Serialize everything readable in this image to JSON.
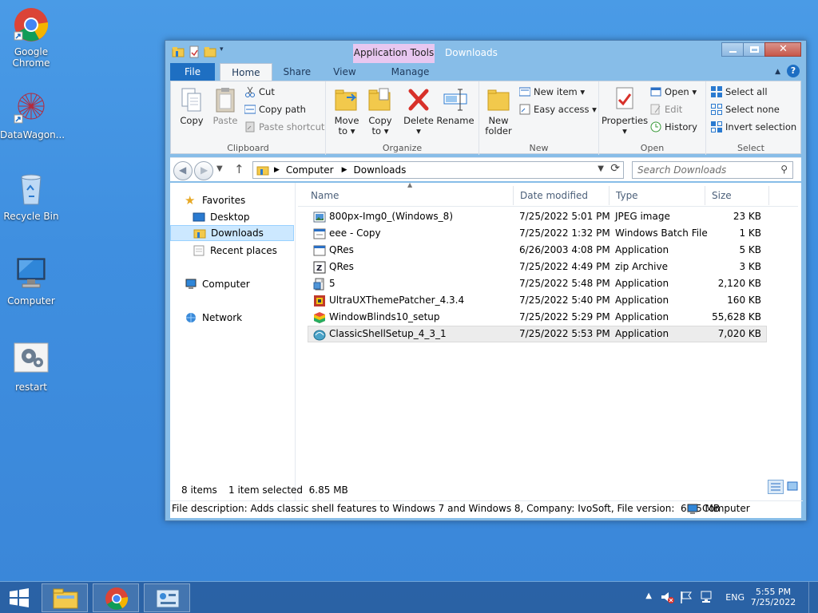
{
  "desktop": {
    "icons": [
      {
        "label": "Google Chrome",
        "icon": "chrome-icon"
      },
      {
        "label": "DataWagon...",
        "icon": "datawagon-icon"
      },
      {
        "label": "Recycle Bin",
        "icon": "recycle-bin-icon"
      },
      {
        "label": "Computer",
        "icon": "computer-icon"
      },
      {
        "label": "restart",
        "icon": "restart-icon"
      }
    ]
  },
  "window": {
    "title": "Downloads",
    "context_tab": "Application Tools",
    "tabs": [
      "File",
      "Home",
      "Share",
      "View",
      "Manage"
    ],
    "help": "?"
  },
  "ribbon": {
    "clipboard": {
      "label": "Clipboard",
      "copy": "Copy",
      "paste": "Paste",
      "cut": "Cut",
      "copy_path": "Copy path",
      "paste_shortcut": "Paste shortcut"
    },
    "organize": {
      "label": "Organize",
      "move_to": "Move to ▾",
      "copy_to": "Copy to ▾",
      "delete": "Delete ▾",
      "rename": "Rename"
    },
    "new": {
      "label": "New",
      "new_folder": "New folder",
      "new_item": "New item ▾",
      "easy_access": "Easy access ▾"
    },
    "open": {
      "label": "Open",
      "properties": "Properties ▾",
      "open": "Open ▾",
      "edit": "Edit",
      "history": "History"
    },
    "select": {
      "label": "Select",
      "select_all": "Select all",
      "select_none": "Select none",
      "invert": "Invert selection"
    }
  },
  "address": {
    "crumbs": [
      "Computer",
      "Downloads"
    ],
    "search_placeholder": "Search Downloads"
  },
  "navpane": {
    "favorites": "Favorites",
    "desktop": "Desktop",
    "downloads": "Downloads",
    "recent": "Recent places",
    "computer": "Computer",
    "network": "Network"
  },
  "columns": [
    "Name",
    "Date modified",
    "Type",
    "Size"
  ],
  "files": [
    {
      "name": "800px-Img0_(Windows_8)",
      "date": "7/25/2022 5:01 PM",
      "type": "JPEG image",
      "size": "23 KB",
      "icon": "jpeg-icon"
    },
    {
      "name": "eee - Copy",
      "date": "7/25/2022 1:32 PM",
      "type": "Windows Batch File",
      "size": "1 KB",
      "icon": "batch-icon"
    },
    {
      "name": "QRes",
      "date": "6/26/2003 4:08 PM",
      "type": "Application",
      "size": "5 KB",
      "icon": "app-icon"
    },
    {
      "name": "QRes",
      "date": "7/25/2022 4:49 PM",
      "type": "zip Archive",
      "size": "3 KB",
      "icon": "zip-icon"
    },
    {
      "name": "5",
      "date": "7/25/2022 5:48 PM",
      "type": "Application",
      "size": "2,120 KB",
      "icon": "setup-icon"
    },
    {
      "name": "UltraUXThemePatcher_4.3.4",
      "date": "7/25/2022 5:40 PM",
      "type": "Application",
      "size": "160 KB",
      "icon": "patcher-icon"
    },
    {
      "name": "WindowBlinds10_setup",
      "date": "7/25/2022 5:29 PM",
      "type": "Application",
      "size": "55,628 KB",
      "icon": "windowblinds-icon"
    },
    {
      "name": "ClassicShellSetup_4_3_1",
      "date": "7/25/2022 5:53 PM",
      "type": "Application",
      "size": "7,020 KB",
      "icon": "classicshell-icon"
    }
  ],
  "status": {
    "items": "8 items",
    "selected": "1 item selected  6.85 MB",
    "description": "File description: Adds classic shell features to Windows 7 and Windows 8, Company: IvoSoft, File version:  6.85 MB",
    "location": "Computer"
  },
  "taskbar": {
    "lang": "ENG",
    "time": "5:55 PM",
    "date": "7/25/2022"
  }
}
